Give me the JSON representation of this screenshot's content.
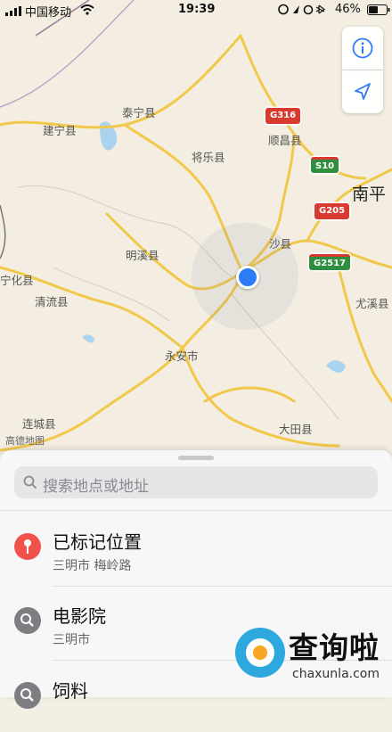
{
  "status_bar": {
    "carrier": "中国移动",
    "time": "19:39",
    "battery": "46%"
  },
  "map": {
    "attribution": "高德地图",
    "places": {
      "taining": "泰宁县",
      "jianning": "建宁县",
      "jiangle": "将乐县",
      "shunchang": "顺昌县",
      "nanping": "南平",
      "mingxi": "明溪县",
      "shaxian": "沙县",
      "ninghua": "宁化县",
      "qingliu": "清流县",
      "youxi": "尤溪县",
      "yongan": "永安市",
      "liancheng": "连城县",
      "datian": "大田县"
    },
    "shields": {
      "g316": "G316",
      "s10": "S10",
      "g205": "G205",
      "g2517": "G2517"
    },
    "colors": {
      "road": "#f2c84b",
      "water": "#a9d3ee"
    }
  },
  "sheet": {
    "search_placeholder": "搜索地点或地址",
    "results": [
      {
        "title": "已标记位置",
        "subtitle": "三明市 梅岭路",
        "icon": "pin-icon"
      },
      {
        "title": "电影院",
        "subtitle": "三明市",
        "icon": "search-icon"
      },
      {
        "title": "饲料",
        "subtitle": "",
        "icon": "search-icon"
      }
    ]
  },
  "watermark": {
    "brand": "查询啦",
    "url": "chaxunla.com"
  }
}
